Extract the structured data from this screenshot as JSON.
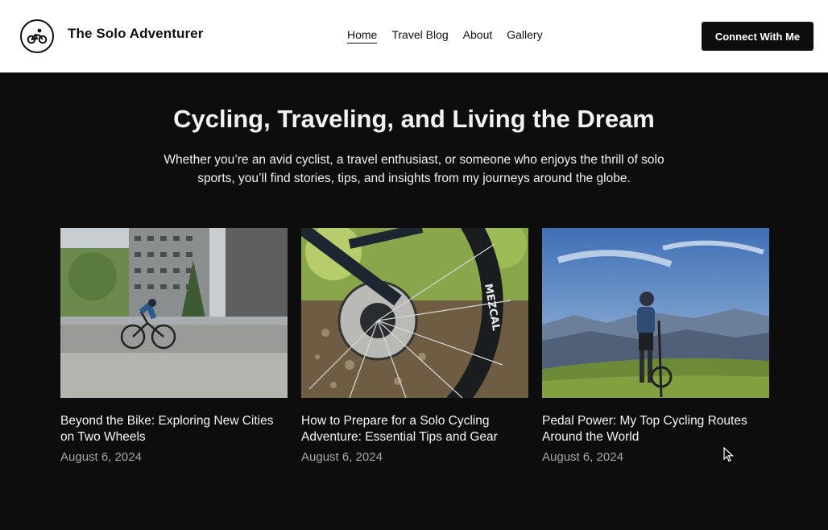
{
  "header": {
    "site_title": "The Solo Adventurer",
    "logo_icon": "bicycle-rider-icon",
    "nav": [
      {
        "label": "Home",
        "active": true
      },
      {
        "label": "Travel Blog",
        "active": false
      },
      {
        "label": "About",
        "active": false
      },
      {
        "label": "Gallery",
        "active": false
      }
    ],
    "cta_label": "Connect With Me"
  },
  "hero": {
    "title": "Cycling, Traveling, and Living the Dream",
    "subtitle": "Whether you’re an avid cyclist, a travel enthusiast, or someone who enjoys the thrill of solo sports, you’ll find stories, tips, and insights from my journeys around the globe."
  },
  "posts": [
    {
      "title": "Beyond the Bike: Exploring New Cities on Two Wheels",
      "date": "August 6, 2024",
      "image": "cyclist-city-street-photo"
    },
    {
      "title": "How to Prepare for a Solo Cycling Adventure: Essential Tips and Gear",
      "date": "August 6, 2024",
      "image": "bicycle-wheel-closeup-photo"
    },
    {
      "title": "Pedal Power: My Top Cycling Routes Around the World",
      "date": "August 6, 2024",
      "image": "cyclist-mountain-view-photo"
    }
  ],
  "colors": {
    "background": "#0d0d0d",
    "header": "#ffffff",
    "accent": "#0d0d0d"
  }
}
